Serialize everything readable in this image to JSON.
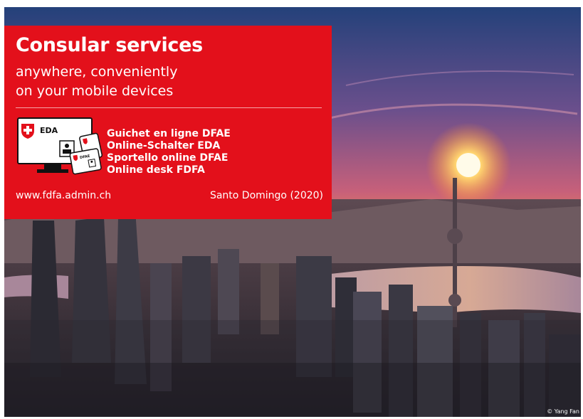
{
  "card": {
    "title": "Consular services",
    "subtitle_line1": "anywhere, conveniently",
    "subtitle_line2": "on your mobile devices",
    "logo_text": "EDA",
    "badge_text": "DFAE",
    "desk_names": [
      "Guichet en ligne DFAE",
      "Online-Schalter EDA",
      "Sportello online DFAE",
      "Online desk FDFA"
    ],
    "website": "www.fdfa.admin.ch",
    "location": "Santo Domingo (2020)"
  },
  "photo": {
    "credit": "© Yang Fan"
  },
  "colors": {
    "brand_red": "#e3101b"
  }
}
